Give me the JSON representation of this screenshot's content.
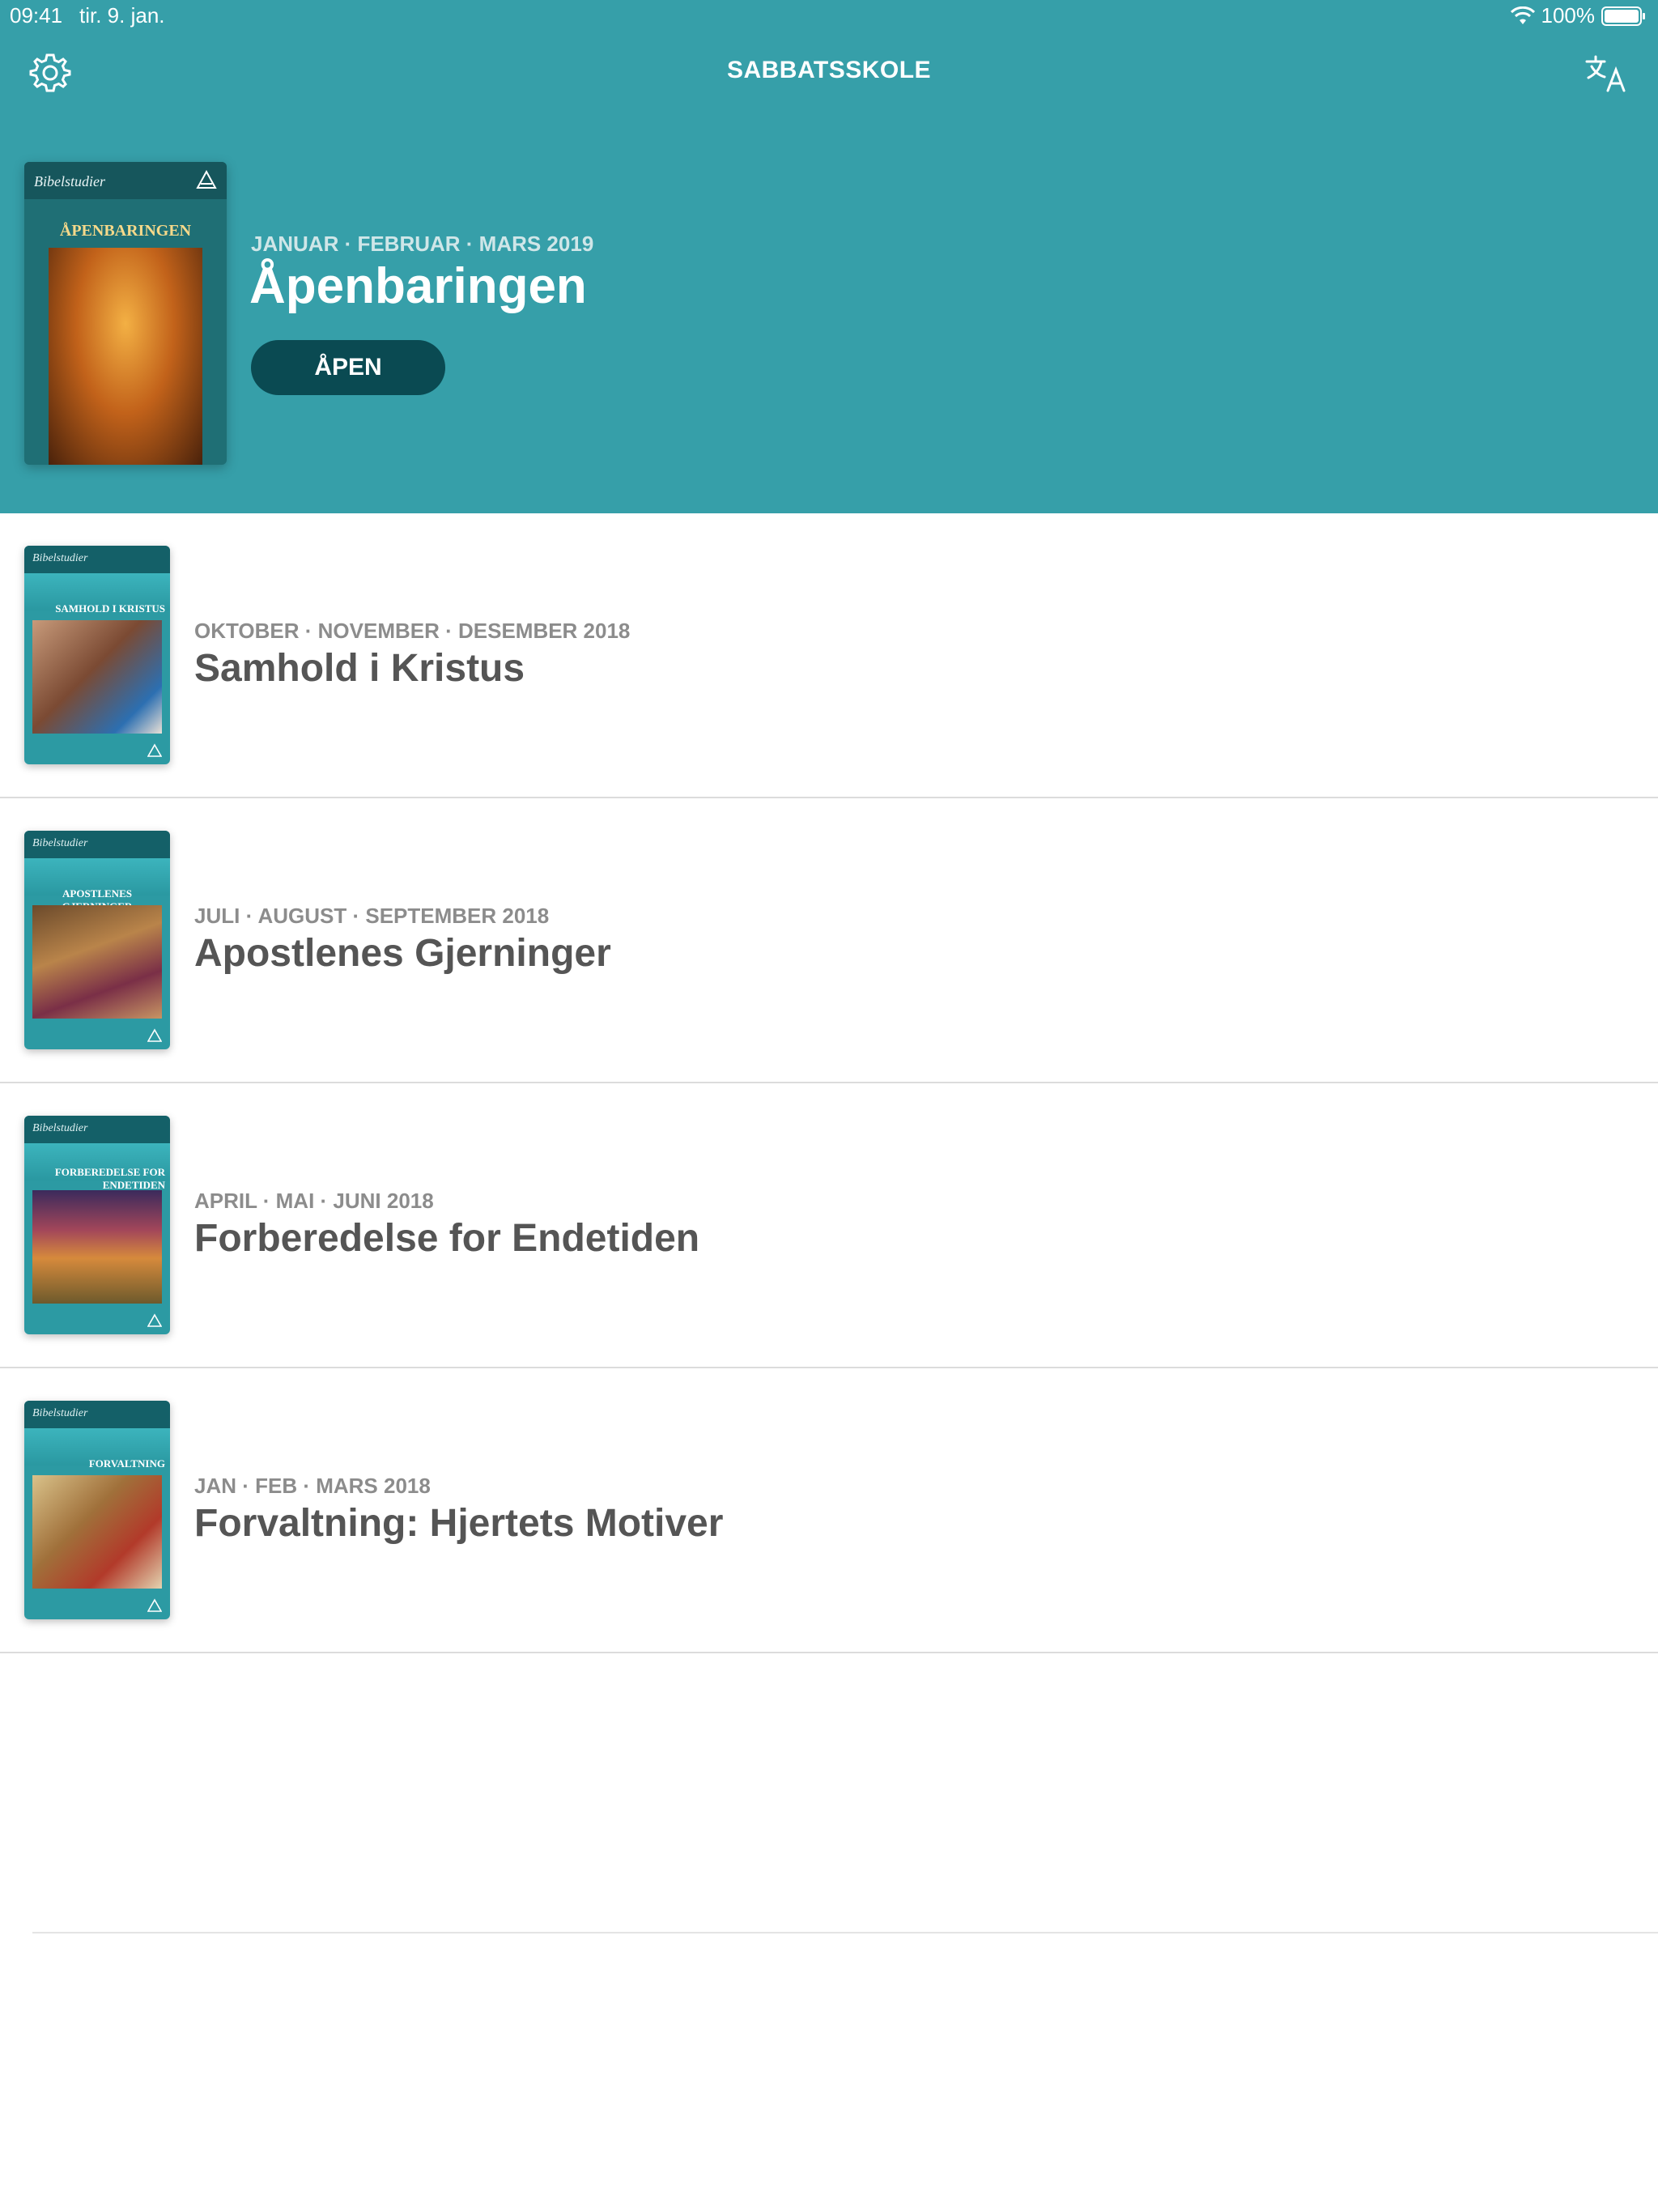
{
  "status_bar": {
    "time": "09:41",
    "date": "tir. 9. jan.",
    "battery": "100%"
  },
  "header": {
    "title": "SABBATSSKOLE",
    "settings_icon": "gear-icon",
    "language_icon": "translate-icon",
    "background_color": "#369fa9"
  },
  "featured": {
    "cover_brand": "Bibelstudier",
    "cover_title": "ÅPENBARINGEN",
    "dates": "JANUAR · FEBRUAR · MARS 2019",
    "title": "Åpenbaringen",
    "open_label": "ÅPEN",
    "button_color": "#0a4a52"
  },
  "quarterlies": [
    {
      "cover_brand": "Bibelstudier",
      "cover_title": "SAMHOLD I KRISTUS",
      "dates": "OKTOBER · NOVEMBER · DESEMBER 2018",
      "title": "Samhold i Kristus"
    },
    {
      "cover_brand": "Bibelstudier",
      "cover_title": "APOSTLENES GJERNINGER",
      "dates": "JULI · AUGUST · SEPTEMBER 2018",
      "title": "Apostlenes Gjerninger"
    },
    {
      "cover_brand": "Bibelstudier",
      "cover_title": "FORBEREDELSE FOR ENDETIDEN",
      "dates": "APRIL · MAI · JUNI 2018",
      "title": "Forberedelse for Endetiden"
    },
    {
      "cover_brand": "Bibelstudier",
      "cover_title": "FORVALTNING",
      "dates": "JAN · FEB · MARS 2018",
      "title": "Forvaltning: Hjertets Motiver"
    }
  ]
}
